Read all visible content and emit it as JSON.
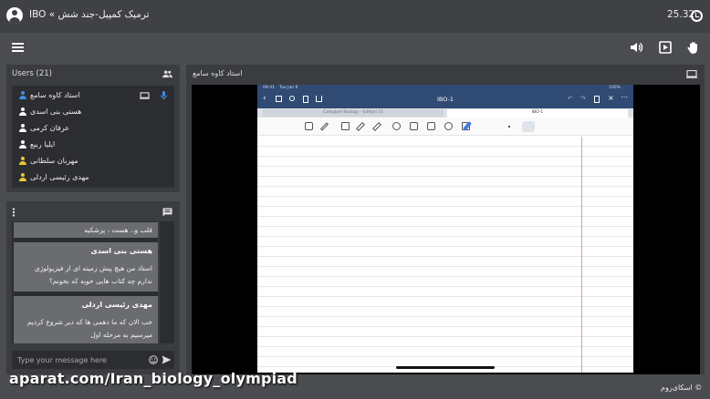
{
  "header": {
    "title": "IBO « ترمیک کمپیل-جند شش",
    "time": "25.32"
  },
  "users_panel": {
    "title": "Users (21)",
    "users": [
      {
        "name": "استاد کاوه سامع",
        "color": "#3f8ee8"
      },
      {
        "name": "هستی بنی اسدی",
        "color": "#ffffff"
      },
      {
        "name": "عرفان کرمی",
        "color": "#ffffff"
      },
      {
        "name": "ایلیا ربیع",
        "color": "#ffffff"
      },
      {
        "name": "مهربان سلطانی",
        "color": "#e6c93a"
      },
      {
        "name": "مهدی رئیسی اردلی",
        "color": "#e6c93a"
      }
    ]
  },
  "chat": {
    "messages": [
      {
        "sender": "",
        "lines": [
          "قلب و.. هست ، پزشکیه"
        ]
      },
      {
        "sender": "هستی بنی اسدی",
        "lines": [
          "استاد من هیچ پیش زمینه ای از فیزیولوژی",
          "ندارم چه کتاب هایی خوبه که بخونم؟"
        ]
      },
      {
        "sender": "مهدی رئیسی اردلی",
        "lines": [
          "خب الان که ما دهمی ها که دیر شروع کردیم",
          "میرسیم به مرحله اول"
        ]
      }
    ],
    "placeholder": "Type your message here"
  },
  "stage": {
    "presenter": "استاد کاوه سامع"
  },
  "ipad": {
    "status_time": "09:41",
    "status_date": "Tue Jan 9",
    "battery": "100%",
    "doc_title": "IBO-1",
    "tab_left": "Campbell Biology - Edition 11",
    "tab_right": "IBO-1"
  },
  "watermark": "aparat.com/Iran_biology_olympiad",
  "brand": "اسکای‌روم ©"
}
